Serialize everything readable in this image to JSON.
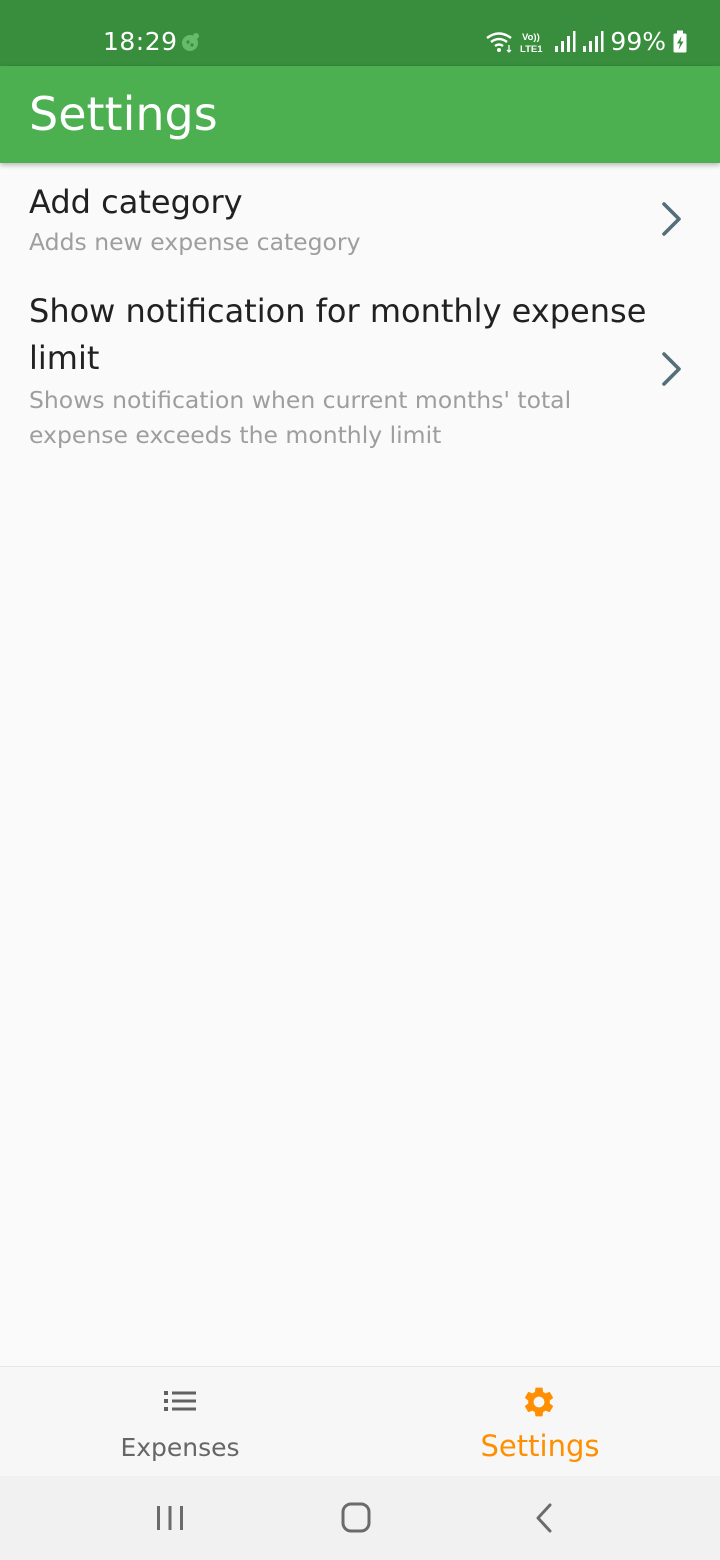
{
  "status_bar": {
    "time": "18:29",
    "network_label": "Vo))\nLTE1",
    "battery": "99%"
  },
  "app_bar": {
    "title": "Settings"
  },
  "preferences": [
    {
      "title": "Add category",
      "summary": "Adds new expense category"
    },
    {
      "title": "Show notification for monthly expense limit",
      "summary": "Shows notification when current months' total expense exceeds the monthly limit"
    }
  ],
  "bottom_nav": {
    "items": [
      {
        "label": "Expenses",
        "icon": "list-icon",
        "selected": false
      },
      {
        "label": "Settings",
        "icon": "gear-icon",
        "selected": true
      }
    ]
  },
  "system_nav": [
    "recent-apps-icon",
    "home-icon",
    "back-icon"
  ],
  "colors": {
    "status_bar": "#388e3c",
    "app_bar": "#4caf50",
    "accent": "#ff8f00",
    "chevron": "#546e7a"
  }
}
